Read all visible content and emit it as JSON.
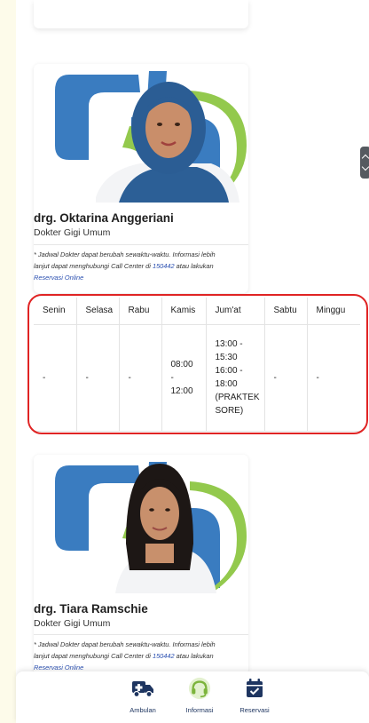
{
  "doctors": [
    {
      "name": "drg. Oktarina Anggeriani",
      "specialty": "Dokter Gigi Umum",
      "note": {
        "line1": "* Jadwal Dokter dapat berubah sewaktu-waktu. Informasi lebih",
        "line2_pre": "lanjut dapat menghubungi Call Center di ",
        "phone": "150442",
        "line2_post": " atau lakukan",
        "link": "Reservasi Online"
      },
      "schedule": {
        "headers": [
          "Senin",
          "Selasa",
          "Rabu",
          "Kamis",
          "Jum'at",
          "Sabtu",
          "Minggu"
        ],
        "senin": "-",
        "selasa": "-",
        "rabu": "-",
        "kamis": [
          "08:00",
          "-",
          "12:00"
        ],
        "jumat": [
          "13:00 -",
          "15:30",
          "16:00 -",
          "18:00",
          "(PRAKTEK",
          "SORE)"
        ],
        "sabtu": "-",
        "minggu": "-"
      }
    },
    {
      "name": "drg. Tiara Ramschie",
      "specialty": "Dokter Gigi Umum",
      "note": {
        "line1": "* Jadwal Dokter dapat berubah sewaktu-waktu. Informasi lebih",
        "line2_pre": "lanjut dapat menghubungi Call Center di ",
        "phone": "150442",
        "line2_post": " atau lakukan",
        "link": "Reservasi Online"
      }
    }
  ],
  "bottom_nav": {
    "items": [
      {
        "label": "Ambulan",
        "icon": "ambulance-icon"
      },
      {
        "label": "Informasi",
        "icon": "headset-icon"
      },
      {
        "label": "Reservasi",
        "icon": "calendar-check-icon"
      }
    ]
  },
  "colors": {
    "brand_blue": "#3a7cc0",
    "brand_green": "#93c94d",
    "nav_dark": "#1e3560",
    "highlight_red": "#e02424"
  }
}
